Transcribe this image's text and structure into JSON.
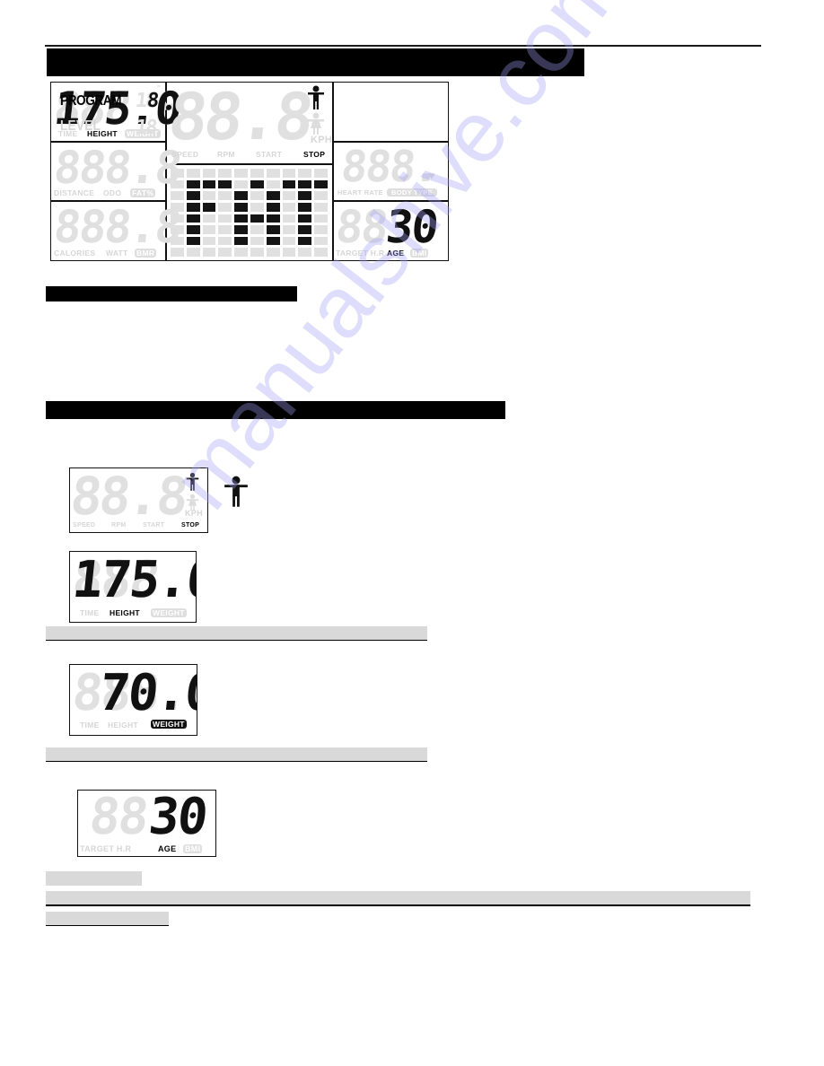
{
  "page": {
    "watermark": "manualshive.com"
  },
  "top_display": {
    "height_panel": {
      "ghost_digits": "888.8",
      "value": "175.0",
      "unit_mark": "\"",
      "labels": [
        "TIME",
        "HEIGHT",
        "WEIGHT"
      ],
      "active_label": "HEIGHT"
    },
    "distance_panel": {
      "ghost_digits": "888.8",
      "labels": [
        "DISTANCE",
        "ODO",
        "FAT%"
      ]
    },
    "calories_panel": {
      "ghost_digits": "888.8",
      "labels": [
        "CALORIES",
        "WATT",
        "BMR"
      ]
    },
    "speed_panel": {
      "ghost_digits": "88.8",
      "unit": "KPH",
      "labels": [
        "SPEED",
        "RPM",
        "START",
        "STOP"
      ],
      "active_label": "STOP",
      "gender_active": "male-icon"
    },
    "profile_grid": {
      "columns": 10,
      "rows": 8,
      "on_cells": [
        [
          1,
          1
        ],
        [
          1,
          2
        ],
        [
          1,
          3
        ],
        [
          1,
          5
        ],
        [
          1,
          7
        ],
        [
          1,
          8
        ],
        [
          1,
          9
        ],
        [
          2,
          1
        ],
        [
          2,
          4
        ],
        [
          2,
          6
        ],
        [
          2,
          8
        ],
        [
          3,
          1
        ],
        [
          3,
          2
        ],
        [
          3,
          4
        ],
        [
          3,
          6
        ],
        [
          3,
          8
        ],
        [
          4,
          1
        ],
        [
          4,
          4
        ],
        [
          4,
          5
        ],
        [
          4,
          6
        ],
        [
          4,
          8
        ],
        [
          5,
          1
        ],
        [
          5,
          4
        ],
        [
          5,
          6
        ],
        [
          5,
          8
        ],
        [
          6,
          1
        ],
        [
          6,
          4
        ],
        [
          6,
          6
        ],
        [
          6,
          8
        ]
      ]
    },
    "program_panel": {
      "program_label": "PROGRAM",
      "program_value": "8",
      "level_label": "LEVEL",
      "level_ghost": "18"
    },
    "heart_panel": {
      "ghost_digits": "888.",
      "labels": [
        "HEART RATE",
        "BODY TYPE"
      ],
      "heart_icon": "heart-icon"
    },
    "age_panel": {
      "ghost_digits": "88",
      "value": "30",
      "labels": [
        "TARGET H.R",
        "AGE",
        "BMI"
      ],
      "active_label": "AGE"
    }
  },
  "figures": {
    "speed_display": {
      "ghost_digits": "88.8",
      "unit": "KPH",
      "labels": [
        "SPEED",
        "RPM",
        "START",
        "STOP"
      ],
      "active_label": "STOP"
    },
    "gender_icon_caption": "male-icon",
    "height_display": {
      "ghost_digits": "888.8",
      "value": "175.0",
      "labels": [
        "TIME",
        "HEIGHT",
        "WEIGHT"
      ],
      "active_label": "HEIGHT"
    },
    "weight_display": {
      "ghost_digits": "888.8",
      "value": "70.0",
      "labels": [
        "TIME",
        "HEIGHT",
        "WEIGHT"
      ],
      "active_label": "WEIGHT"
    },
    "age_display": {
      "ghost_digits": "88",
      "value": "30",
      "labels": [
        "TARGET H.R",
        "AGE",
        "BMI"
      ],
      "active_label": "AGE"
    }
  }
}
